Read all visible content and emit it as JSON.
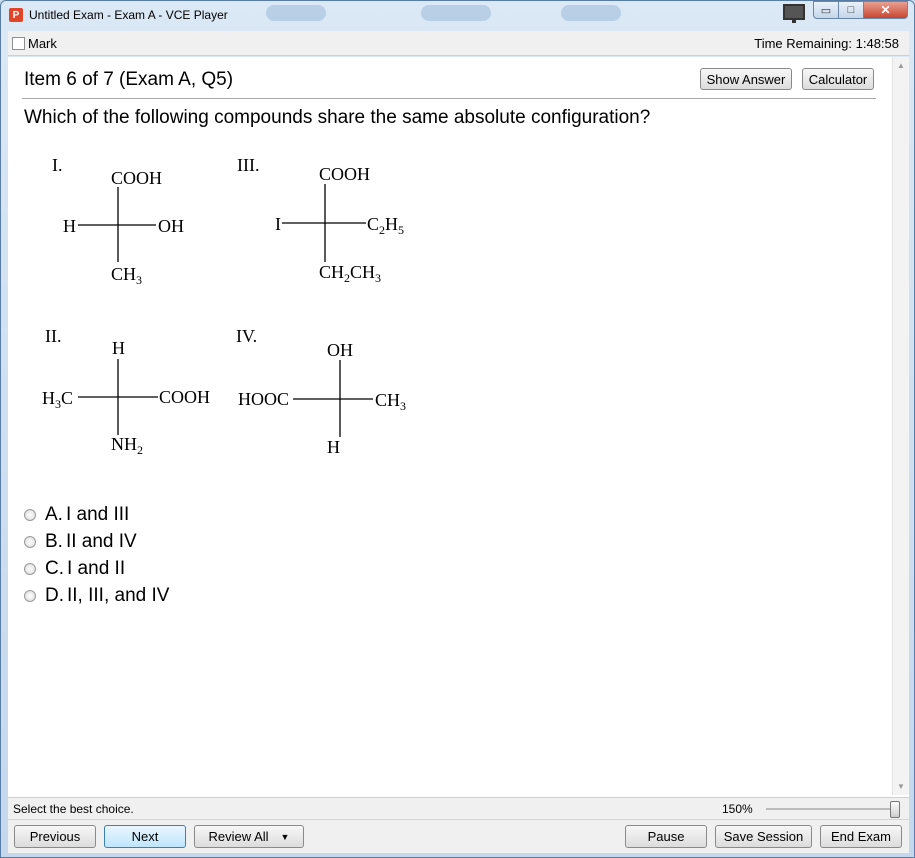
{
  "window": {
    "title": "Untitled Exam - Exam A - VCE Player",
    "app_icon_letter": "P",
    "minimize_glyph": "▭",
    "maximize_glyph": "□",
    "close_glyph": "✕"
  },
  "markbar": {
    "mark_label": "Mark",
    "time_remaining": "Time Remaining: 1:48:58"
  },
  "header": {
    "item_title": "Item 6 of 7  (Exam A, Q5)",
    "show_answer_label": "Show Answer",
    "calculator_label": "Calculator"
  },
  "question": {
    "text": "Which of the following compounds share the same absolute configuration?"
  },
  "figure": {
    "I": {
      "label": "I.",
      "top": "COOH",
      "left": "H",
      "right": "OH",
      "bottom": "CH",
      "bottom_sub": "3"
    },
    "III": {
      "label": "III.",
      "top": "COOH",
      "left": "I",
      "right": "C",
      "right_sub1": "2",
      "right_rest": "H",
      "right_sub2": "5",
      "bottom": "CH",
      "bottom_sub": "2",
      "bottom_rest": "CH",
      "bottom_sub2": "3"
    },
    "II": {
      "label": "II.",
      "top": "H",
      "left": "H",
      "left_sub": "3",
      "left_rest": "C",
      "right": "COOH",
      "bottom": "NH",
      "bottom_sub": "2"
    },
    "IV": {
      "label": "IV.",
      "top": "OH",
      "left": "HOOC",
      "right": "CH",
      "right_sub": "3",
      "bottom": "H"
    }
  },
  "options": [
    {
      "letter": "A.",
      "text": "I and III"
    },
    {
      "letter": "B.",
      "text": "II and IV"
    },
    {
      "letter": "C.",
      "text": "I and II"
    },
    {
      "letter": "D.",
      "text": "II, III, and IV"
    }
  ],
  "statusbar": {
    "instruction": "Select the best choice.",
    "zoom": "150%"
  },
  "navbar": {
    "previous": "Previous",
    "next": "Next",
    "review_all": "Review All",
    "pause": "Pause",
    "save_session": "Save Session",
    "end_exam": "End Exam"
  }
}
